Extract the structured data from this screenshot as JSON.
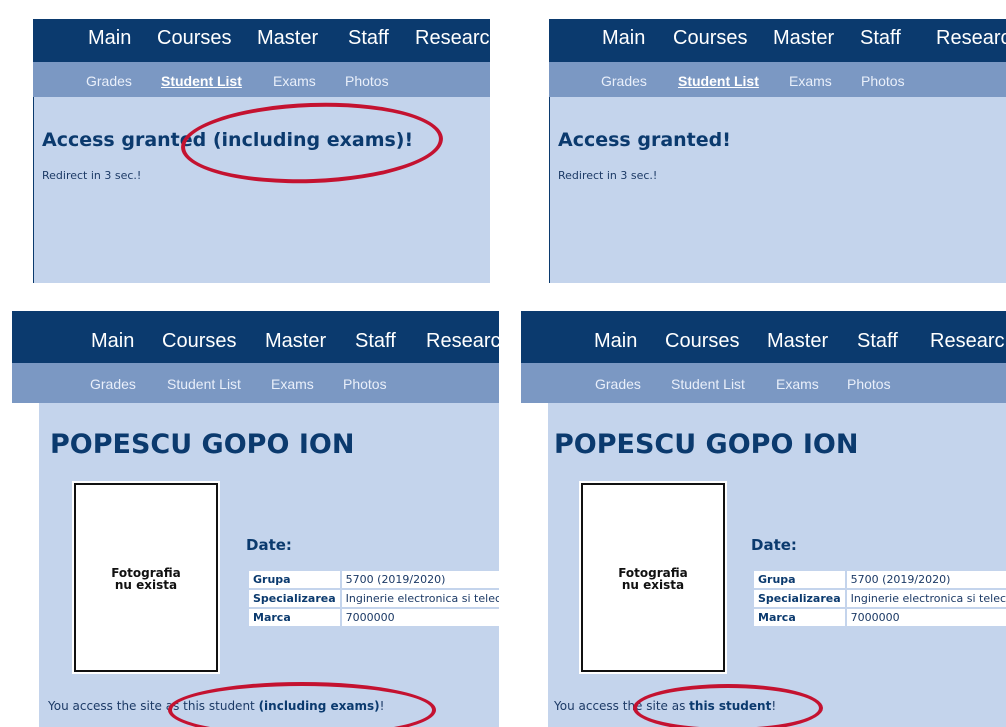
{
  "nav": {
    "main": "Main",
    "courses": "Courses",
    "master": "Master",
    "staff": "Staff",
    "research": "Researc"
  },
  "subnav": {
    "grades": "Grades",
    "student_list": "Student List",
    "exams": "Exams",
    "photos": "Photos"
  },
  "panel1": {
    "heading": "Access granted (including exams)!",
    "redirect": "Redirect in 3 sec.!"
  },
  "panel2": {
    "heading": "Access granted!",
    "redirect": "Redirect in 3 sec.!"
  },
  "student": {
    "name": "POPESCU GOPO ION",
    "photo_placeholder": "Fotografia\nnu exista",
    "date_label": "Date:",
    "rows": [
      {
        "label": "Grupa",
        "value": "5700 (2019/2020)"
      },
      {
        "label": "Specializarea",
        "value": "Inginerie electronica si telec"
      },
      {
        "label": "Marca",
        "value": "7000000"
      }
    ]
  },
  "panel3": {
    "footer_prefix": "You access the site as this student ",
    "footer_bold": "(including exams)",
    "footer_suffix": "!"
  },
  "panel4": {
    "footer_prefix": "You access the site as ",
    "footer_bold": "this student",
    "footer_suffix": "!"
  },
  "colors": {
    "nav_bg": "#0b3a6e",
    "subnav_bg": "#7b98c3",
    "content_bg": "#c4d4ec",
    "highlight": "#c41230"
  }
}
